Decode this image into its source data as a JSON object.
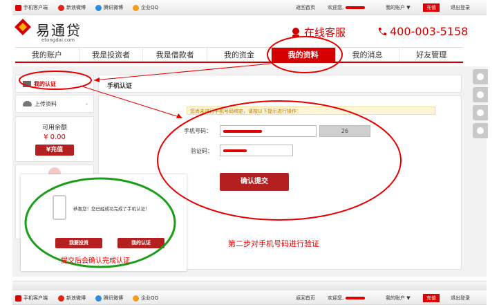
{
  "topbar": {
    "client": "手机客户端",
    "weibo": "新浪微博",
    "tweibo": "腾讯微博",
    "qq": "企业QQ",
    "home": "返回首页",
    "welcome": "欢迎您,",
    "account": "我的账户 ▼",
    "recharge": "充值",
    "logout": "退出登录"
  },
  "header": {
    "logo_text": "易通贷",
    "logo_url": "etongdai.com",
    "service": "在线客服",
    "hotline": "400-003-5158"
  },
  "nav": {
    "items": [
      "我的账户",
      "我是投资者",
      "我是借款者",
      "我的资金",
      "我的资料",
      "我的消息",
      "好友管理"
    ]
  },
  "sidebar": {
    "cert": "我的认证",
    "upload": "上传资料",
    "balance_label": "可用余额",
    "balance_value": "¥ 0.00",
    "recharge_btn": "¥充值"
  },
  "main": {
    "title": "手机认证",
    "notice": "您尚未进行手机号码绑定，请按以下提示进行操作：",
    "phone_label": "手机号码：",
    "countdown": "26",
    "code_label": "验证码：",
    "submit": "确认提交"
  },
  "popup": {
    "message": "恭喜您！您已经成功完成了手机认证！",
    "invest_btn": "我要投资",
    "cert_btn": "我的认证"
  },
  "annotations": {
    "step2": "第二步对手机号码进行验证",
    "confirm": "提交后会确认完成认证"
  },
  "colors": {
    "brand_red": "#d60000",
    "annot_red": "#e60000",
    "annot_green": "#1a9e1a"
  }
}
